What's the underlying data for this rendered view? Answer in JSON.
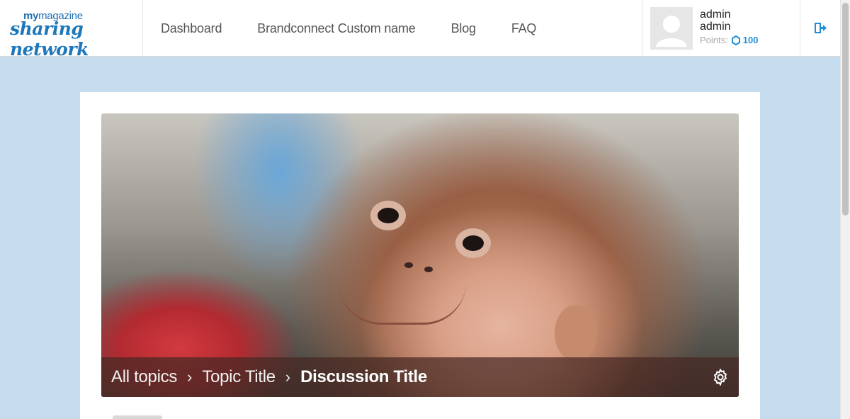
{
  "brand": {
    "top_prefix": "my",
    "top_main": "magazine",
    "bottom": "sharing network"
  },
  "nav": [
    {
      "label": "Dashboard"
    },
    {
      "label": "Brandconnect Custom name"
    },
    {
      "label": "Blog"
    },
    {
      "label": "FAQ"
    }
  ],
  "user": {
    "line1": "admin",
    "line2": "admin",
    "points_label": "Points:",
    "points_value": "100"
  },
  "breadcrumb": {
    "all": "All topics",
    "topic": "Topic Title",
    "current": "Discussion Title",
    "separator": "›"
  },
  "icons": {
    "logout": "logout-icon",
    "points": "points-ring-icon",
    "settings": "gear-icon",
    "avatar": "avatar-placeholder-icon"
  },
  "colors": {
    "accent": "#1d8fd6",
    "background": "#c4dced"
  }
}
